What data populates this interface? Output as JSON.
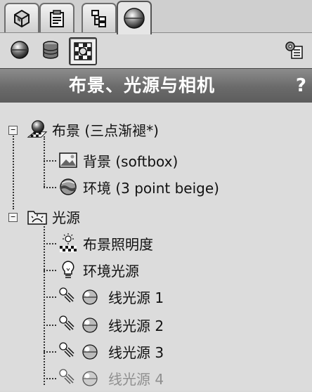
{
  "tabs": [
    {
      "name": "feature-manager",
      "icon": "feature-tree-icon"
    },
    {
      "name": "property-manager",
      "icon": "property-icon"
    },
    {
      "name": "configuration-manager",
      "icon": "configuration-icon"
    },
    {
      "name": "render-manager",
      "icon": "scene-sphere-icon",
      "active": true
    }
  ],
  "toolbar": {
    "buttons": [
      {
        "name": "scene-view-button",
        "icon": "sphere-icon"
      },
      {
        "name": "appearance-view-button",
        "icon": "cylinder-icon"
      },
      {
        "name": "decal-view-button",
        "icon": "checker-icon",
        "pressed": true
      }
    ],
    "right_button": {
      "name": "options-button",
      "icon": "gear-list-icon"
    }
  },
  "panel": {
    "title": "布景、光源与相机",
    "help": "?"
  },
  "tree": {
    "scene": {
      "label": "布景 (三点渐褪*)",
      "icon": "scene-icon",
      "expanded": true
    },
    "scene_children": [
      {
        "label": "背景 (softbox)",
        "icon": "background-image-icon"
      },
      {
        "label": "环境 (3 point beige)",
        "icon": "environment-sphere-icon"
      }
    ],
    "lights": {
      "label": "光源",
      "icon": "lights-folder-icon",
      "expanded": true
    },
    "lights_children": [
      {
        "label": "布景照明度",
        "icon": "scene-illumination-icon"
      },
      {
        "label": "环境光源",
        "icon": "ambient-bulb-icon"
      },
      {
        "label": "线光源 1",
        "icon": "directional-light-icon"
      },
      {
        "label": "线光源 2",
        "icon": "directional-light-icon"
      },
      {
        "label": "线光源 3",
        "icon": "directional-light-icon"
      },
      {
        "label": "线光源 4",
        "icon": "directional-light-icon",
        "dimmed": true
      }
    ],
    "expander_minus": "−"
  }
}
